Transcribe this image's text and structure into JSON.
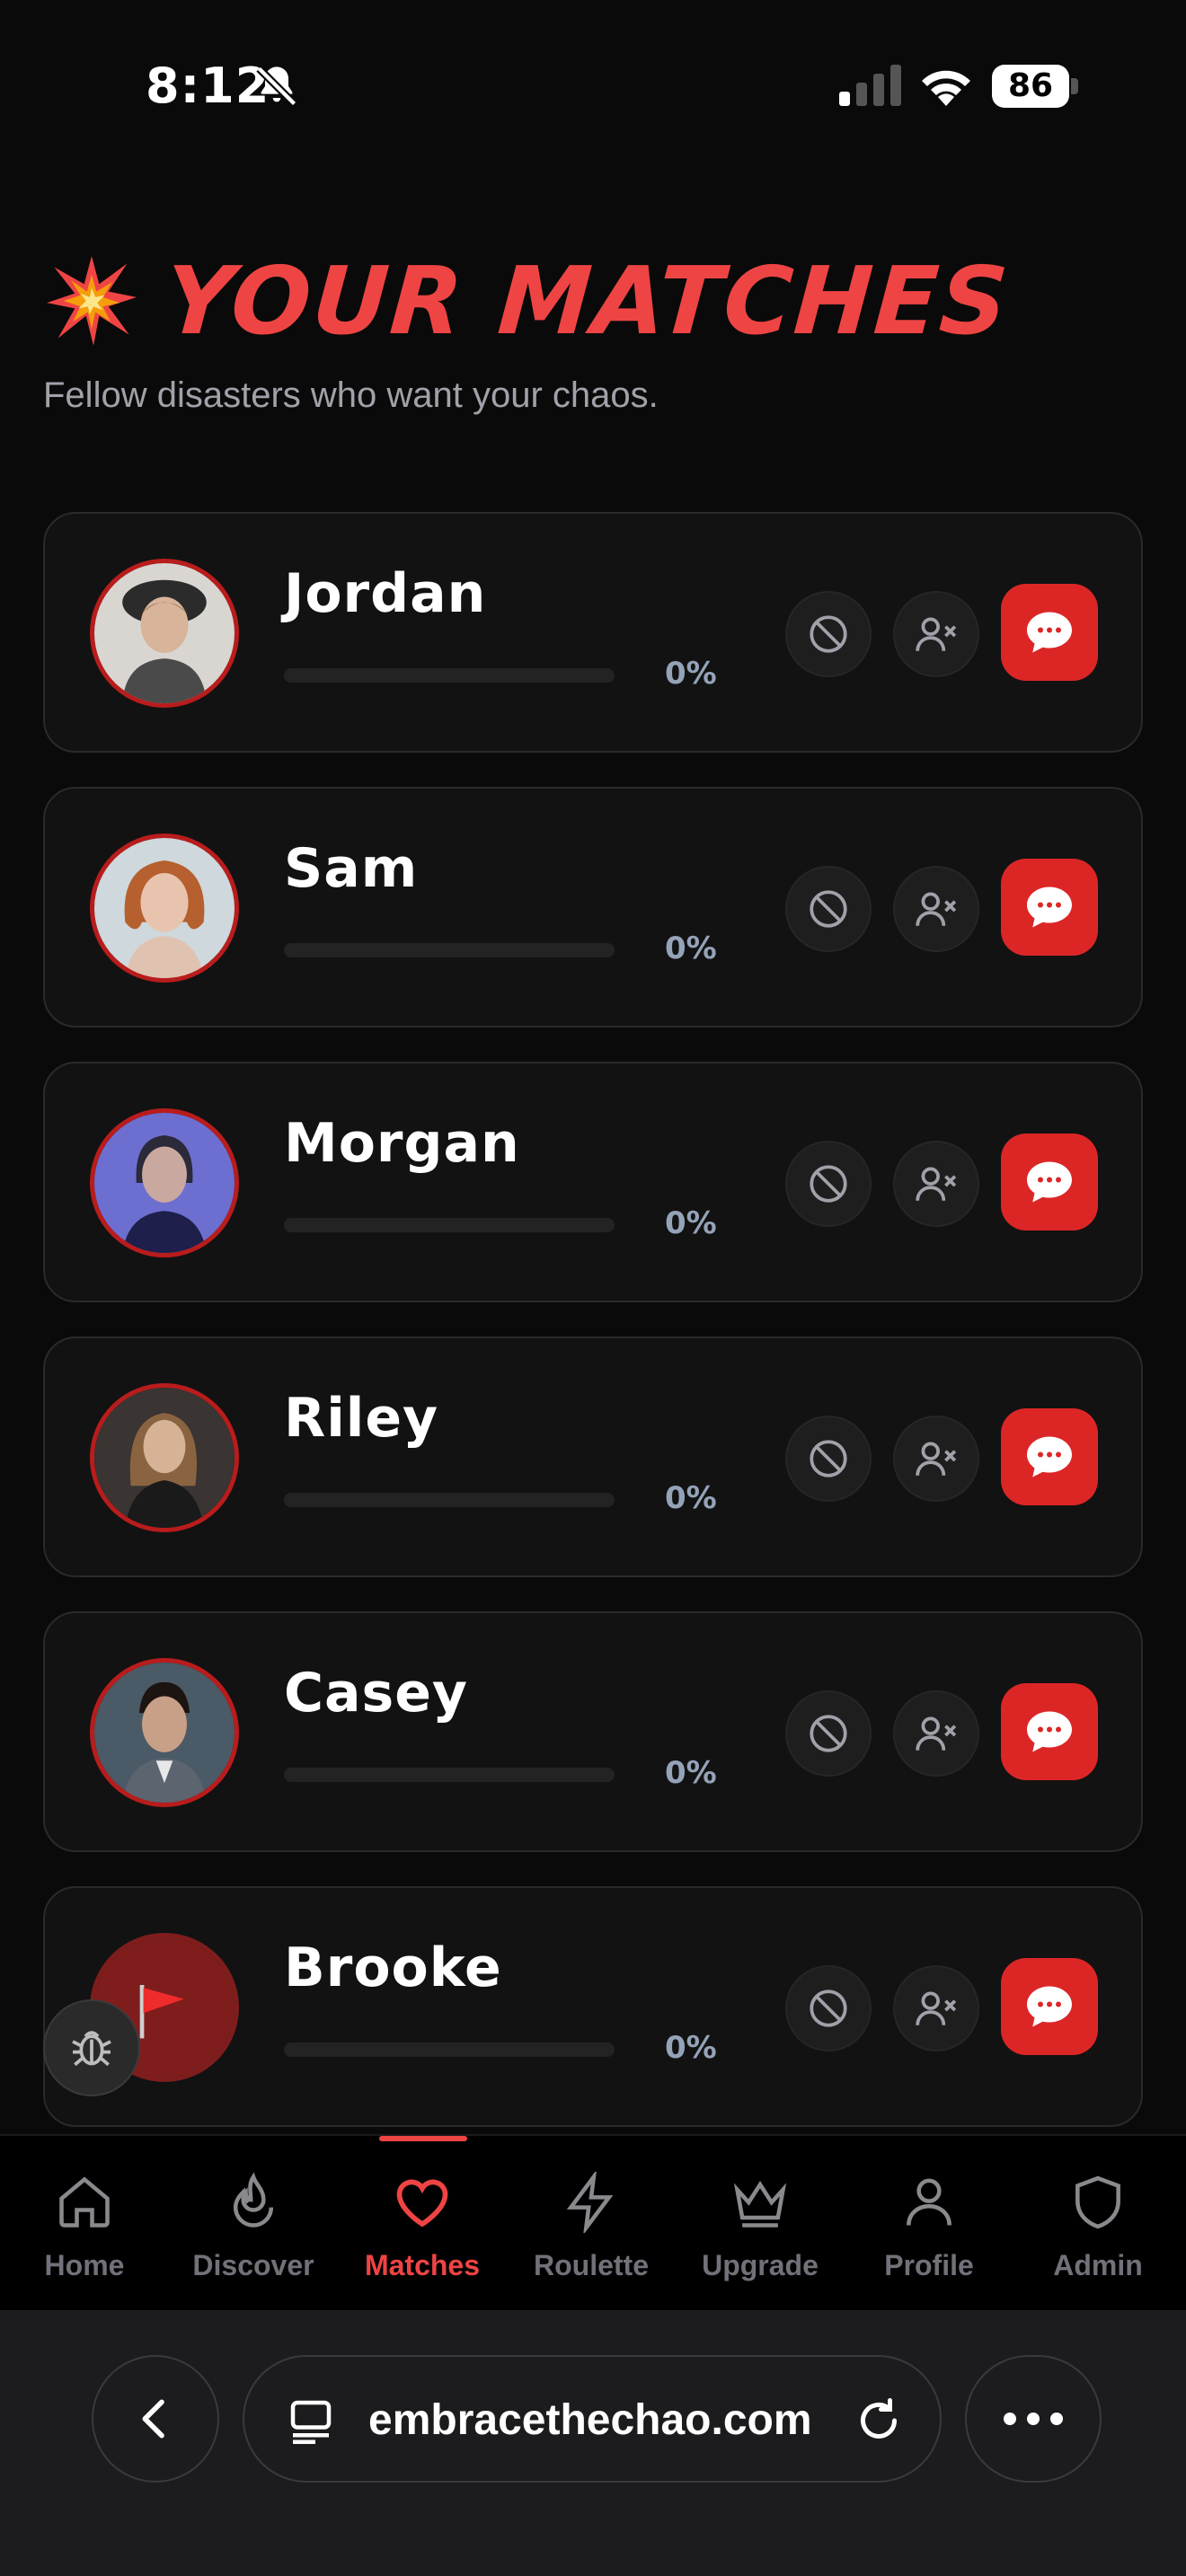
{
  "status_bar": {
    "time": "8:12",
    "battery": "86",
    "icons": [
      "bell-slash-icon",
      "cellular-signal-icon",
      "wifi-icon",
      "battery-icon"
    ]
  },
  "header": {
    "emoji": "💥",
    "title": "YOUR MATCHES",
    "subtitle": "Fellow disasters who want your chaos.",
    "accent_color": "#ef4444"
  },
  "matches": [
    {
      "name": "Jordan",
      "compatibility": "0%",
      "compatibility_value": 0
    },
    {
      "name": "Sam",
      "compatibility": "0%",
      "compatibility_value": 0
    },
    {
      "name": "Morgan",
      "compatibility": "0%",
      "compatibility_value": 0
    },
    {
      "name": "Riley",
      "compatibility": "0%",
      "compatibility_value": 0
    },
    {
      "name": "Casey",
      "compatibility": "0%",
      "compatibility_value": 0
    },
    {
      "name": "Brooke",
      "compatibility": "0%",
      "compatibility_value": 0
    }
  ],
  "card_actions": [
    "block-icon",
    "unmatch-user-icon",
    "message-icon"
  ],
  "bottom_nav": {
    "active": "Matches",
    "items": [
      {
        "label": "Home",
        "icon": "home-icon"
      },
      {
        "label": "Discover",
        "icon": "flame-icon"
      },
      {
        "label": "Matches",
        "icon": "heart-icon"
      },
      {
        "label": "Roulette",
        "icon": "lightning-icon"
      },
      {
        "label": "Upgrade",
        "icon": "crown-icon"
      },
      {
        "label": "Profile",
        "icon": "user-icon"
      },
      {
        "label": "Admin",
        "icon": "shield-icon"
      }
    ]
  },
  "browser": {
    "url": "embracethechao.com"
  },
  "colors": {
    "background": "#0a0a0a",
    "card": "#121212",
    "accent": "#ef4444",
    "message_button": "#dc2626",
    "muted": "#71717a"
  }
}
